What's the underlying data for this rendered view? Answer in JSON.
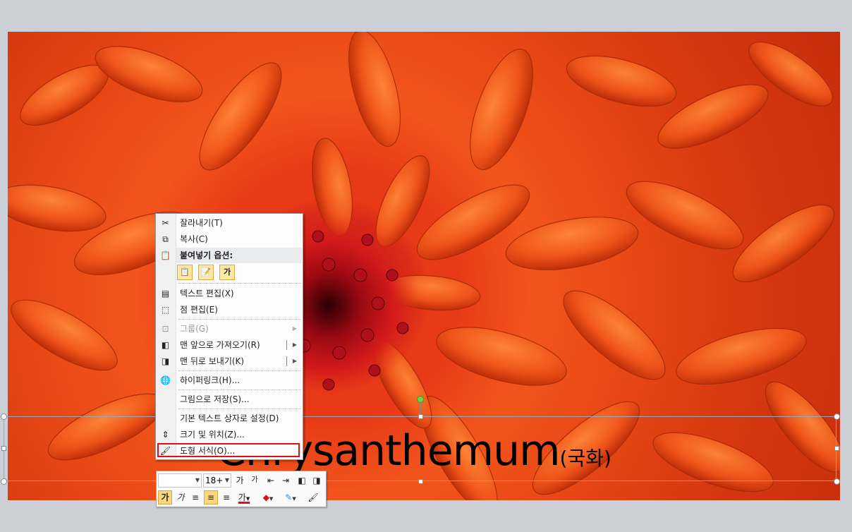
{
  "slide": {
    "title_main": "Chrysanthemum",
    "title_suffix": "(국화)"
  },
  "context_menu": {
    "items": [
      {
        "label": "잘라내기(T)",
        "icon": "scissors-icon"
      },
      {
        "label": "복사(C)",
        "icon": "copy-icon"
      },
      {
        "label": "붙여넣기 옵션:",
        "icon": "paste-icon"
      },
      {
        "label": "텍스트 편집(X)",
        "icon": "text-edit-icon"
      },
      {
        "label": "점 편집(E)",
        "icon": "edit-points-icon"
      },
      {
        "label": "그룹(G)",
        "icon": "group-icon",
        "disabled": true
      },
      {
        "label": "맨 앞으로 가져오기(R)",
        "icon": "bring-to-front-icon"
      },
      {
        "label": "맨 뒤로 보내기(K)",
        "icon": "send-to-back-icon"
      },
      {
        "label": "하이퍼링크(H)...",
        "icon": "hyperlink-icon"
      },
      {
        "label": "그림으로 저장(S)...",
        "icon": ""
      },
      {
        "label": "기본 텍스트 상자로 설정(D)",
        "icon": ""
      },
      {
        "label": "크기 및 위치(Z)...",
        "icon": "size-position-icon"
      },
      {
        "label": "도형 서식(O)...",
        "icon": "format-shape-icon"
      }
    ],
    "paste_options": [
      "keep-source-formatting",
      "merge-formatting",
      "가"
    ]
  },
  "mini_toolbar": {
    "font_name": "",
    "font_size": "18+",
    "grow_font": "가",
    "shrink_font": "가",
    "bold_label": "가",
    "italic_label": "가",
    "font_color_label": "가"
  },
  "colors": {
    "highlight": "#d8111b",
    "rotation_handle": "#6bd24a"
  }
}
